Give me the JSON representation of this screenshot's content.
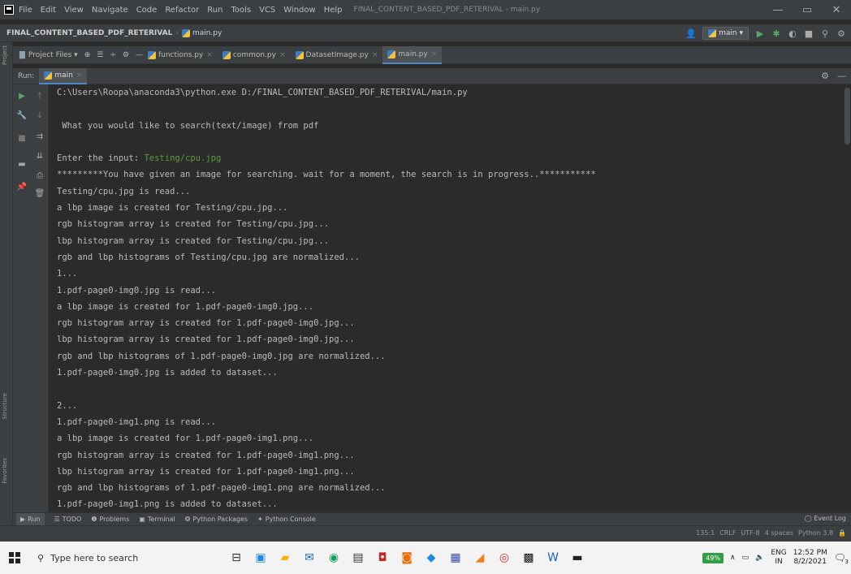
{
  "titlebar": {
    "menu": [
      "File",
      "Edit",
      "View",
      "Navigate",
      "Code",
      "Refactor",
      "Run",
      "Tools",
      "VCS",
      "Window",
      "Help"
    ],
    "window_title": "FINAL_CONTENT_BASED_PDF_RETERIVAL - main.py",
    "controls": [
      "—",
      "▭",
      "✕"
    ]
  },
  "navbar": {
    "project": "FINAL_CONTENT_BASED_PDF_RETERIVAL",
    "file": "main.py",
    "run_config": "main ▾"
  },
  "left_strip": {
    "tabs": [
      "Project",
      "Structure",
      "Favorites"
    ]
  },
  "toolwin": {
    "project_files": "Project Files ▾",
    "tabs": [
      "functions.py",
      "common.py",
      "DatasetImage.py",
      "main.py"
    ]
  },
  "runbar": {
    "title": "Run:",
    "tab": "main"
  },
  "console": {
    "lines": [
      "C:\\Users\\Roopa\\anaconda3\\python.exe D:/FINAL_CONTENT_BASED_PDF_RETERIVAL/main.py",
      "",
      " What you would like to search(text/image) from pdf",
      "",
      "Enter the input: ",
      "*********You have given an image for searching. wait for a moment, the search is in progress..***********",
      "Testing/cpu.jpg is read...",
      "a lbp image is created for Testing/cpu.jpg...",
      "rgb histogram array is created for Testing/cpu.jpg...",
      "lbp histogram array is created for Testing/cpu.jpg...",
      "rgb and lbp histograms of Testing/cpu.jpg are normalized...",
      "1...",
      "1.pdf-page0-img0.jpg is read...",
      "a lbp image is created for 1.pdf-page0-img0.jpg...",
      "rgb histogram array is created for 1.pdf-page0-img0.jpg...",
      "lbp histogram array is created for 1.pdf-page0-img0.jpg...",
      "rgb and lbp histograms of 1.pdf-page0-img0.jpg are normalized...",
      "1.pdf-page0-img0.jpg is added to dataset...",
      "",
      "2...",
      "1.pdf-page0-img1.png is read...",
      "a lbp image is created for 1.pdf-page0-img1.png...",
      "rgb histogram array is created for 1.pdf-page0-img1.png...",
      "lbp histogram array is created for 1.pdf-page0-img1.png...",
      "rgb and lbp histograms of 1.pdf-page0-img1.png are normalized...",
      "1.pdf-page0-img1.png is added to dataset..."
    ],
    "user_input": "Testing/cpu.jpg"
  },
  "bottom_tools": {
    "items": [
      "Run",
      "TODO",
      "Problems",
      "Terminal",
      "Python Packages",
      "Python Console"
    ],
    "event_log": "Event Log"
  },
  "status": {
    "position": "135:1",
    "line_sep": "CRLF",
    "encoding": "UTF-8",
    "indent": "4 spaces",
    "interpreter": "Python 3.8"
  },
  "taskbar": {
    "search_placeholder": "Type here to search",
    "battery": "49%",
    "lang": "ENG",
    "region": "IN",
    "time": "12:52 PM",
    "date": "8/2/2021",
    "notifications": "3"
  },
  "colors": {
    "ide_bg": "#2b2b2b",
    "panel": "#3c3f41",
    "input_green": "#5a9d3a",
    "accent": "#4a88c7"
  }
}
